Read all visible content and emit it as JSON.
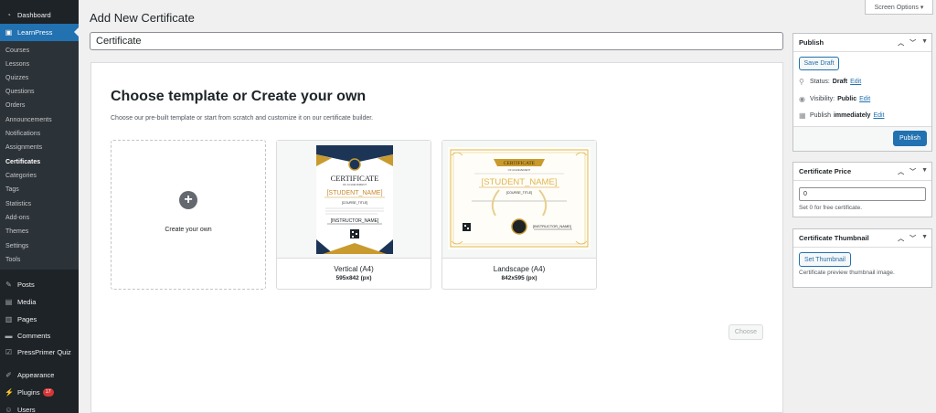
{
  "sidebar": {
    "top_items": [
      {
        "label": "Dashboard",
        "icon": "dashboard-icon"
      },
      {
        "label": "LearnPress",
        "icon": "learnpress-icon"
      }
    ],
    "submenu": [
      "Courses",
      "Lessons",
      "Quizzes",
      "Questions",
      "Orders",
      "Announcements",
      "Notifications",
      "Assignments",
      "Certificates",
      "Categories",
      "Tags",
      "Statistics",
      "Add-ons",
      "Themes",
      "Settings",
      "Tools"
    ],
    "bottom_items": [
      {
        "label": "Posts",
        "icon": "pin-icon"
      },
      {
        "label": "Media",
        "icon": "media-icon"
      },
      {
        "label": "Pages",
        "icon": "pages-icon"
      },
      {
        "label": "Comments",
        "icon": "comments-icon"
      },
      {
        "label": "PressPrimer Quiz",
        "icon": "quiz-icon"
      },
      {
        "label": "Appearance",
        "icon": "brush-icon"
      },
      {
        "label": "Plugins",
        "icon": "plug-icon",
        "badge": "17"
      },
      {
        "label": "Users",
        "icon": "users-icon"
      }
    ]
  },
  "screen_options": "Screen Options ▾",
  "page_title": "Add New Certificate",
  "title_value": "Certificate",
  "main": {
    "heading": "Choose template or Create your own",
    "description": "Choose our pre-built template or start from scratch and customize it on our certificate builder.",
    "create_own_label": "Create your own",
    "templates": [
      {
        "name": "Vertical (A4)",
        "size": "595x842 (px)"
      },
      {
        "name": "Landscape (A4)",
        "size": "842x595 (px)"
      }
    ],
    "choose_button": "Choose"
  },
  "cert_text": {
    "vertical": {
      "title": "CERTIFICATE",
      "sub": "OF ACHIEVEMENT",
      "student": "[STUDENT_NAME]",
      "course": "[COURSE_TITLE]",
      "instructor": "[INSTRUCTOR_NAME]"
    },
    "landscape": {
      "title": "CERTIFICATE",
      "sub": "OF ACHIEVEMENT",
      "student": "[STUDENT_NAME]",
      "course": "[COURSE_TITLE]",
      "instructor": "[INSTRUCTOR_NAME]"
    }
  },
  "publish": {
    "title": "Publish",
    "save_draft": "Save Draft",
    "status_label": "Status:",
    "status_value": "Draft",
    "visibility_label": "Visibility:",
    "visibility_value": "Public",
    "publish_label": "Publish",
    "publish_value": "immediately",
    "edit": "Edit",
    "publish_button": "Publish"
  },
  "price": {
    "title": "Certificate Price",
    "value": "0",
    "hint": "Set 0 for free certificate."
  },
  "thumbnail": {
    "title": "Certificate Thumbnail",
    "button": "Set Thumbnail",
    "hint": "Certificate preview thumbnail image."
  },
  "colors": {
    "accent": "#2271b1",
    "sidebar": "#1d2327",
    "badge": "#d63638"
  }
}
